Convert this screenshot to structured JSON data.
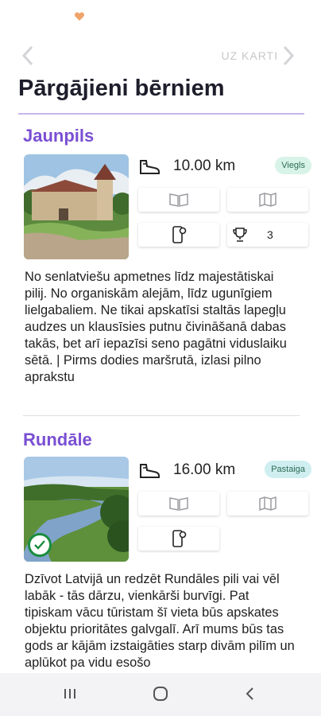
{
  "nav": {
    "map_label": "UZ KARTI"
  },
  "page": {
    "title": "Pārgājieni bērniem"
  },
  "routes": [
    {
      "name": "Jaunpils",
      "distance": "10.00 km",
      "difficulty": "Viegls",
      "trophy_count": "3",
      "completed": false,
      "description": "No senlatviešu apmetnes līdz majestātiskai pilij. No organiskām alejām, līdz ugunīgiem lielgabaliem. Ne tikai apskatīsi staltās lapegļu audzes un klausīsies putnu čivināšanā dabas takās, bet arī iepazīsi seno pagātni viduslaiku sētā. | Pirms dodies maršrutā, izlasi pilno aprakstu"
    },
    {
      "name": "Rundāle",
      "distance": "16.00 km",
      "difficulty": "Pastaiga",
      "completed": true,
      "description": "Dzīvot Latvijā un redzēt Rundāles pili vai vēl labāk - tās dārzu, vienkārši burvīgi. Pat tipiskam vācu tūristam šī vieta būs apskates objektu prioritātes galvgalī. Arī mums būs tas gods ar kājām izstaigāties starp divām pilīm un aplūkot pa vidu esošo"
    }
  ],
  "colors": {
    "accent": "#7a4fd3",
    "badge_easy_bg": "#d8f3e8",
    "badge_walk_bg": "#cfeef0",
    "done": "#1a8d3f"
  },
  "icons": [
    "heart-icon",
    "chevron-left-icon",
    "chevron-right-icon",
    "boot-icon",
    "book-icon",
    "map-icon",
    "phone-location-icon",
    "trophy-icon",
    "check-icon",
    "recent-apps-icon",
    "home-icon",
    "back-icon"
  ]
}
